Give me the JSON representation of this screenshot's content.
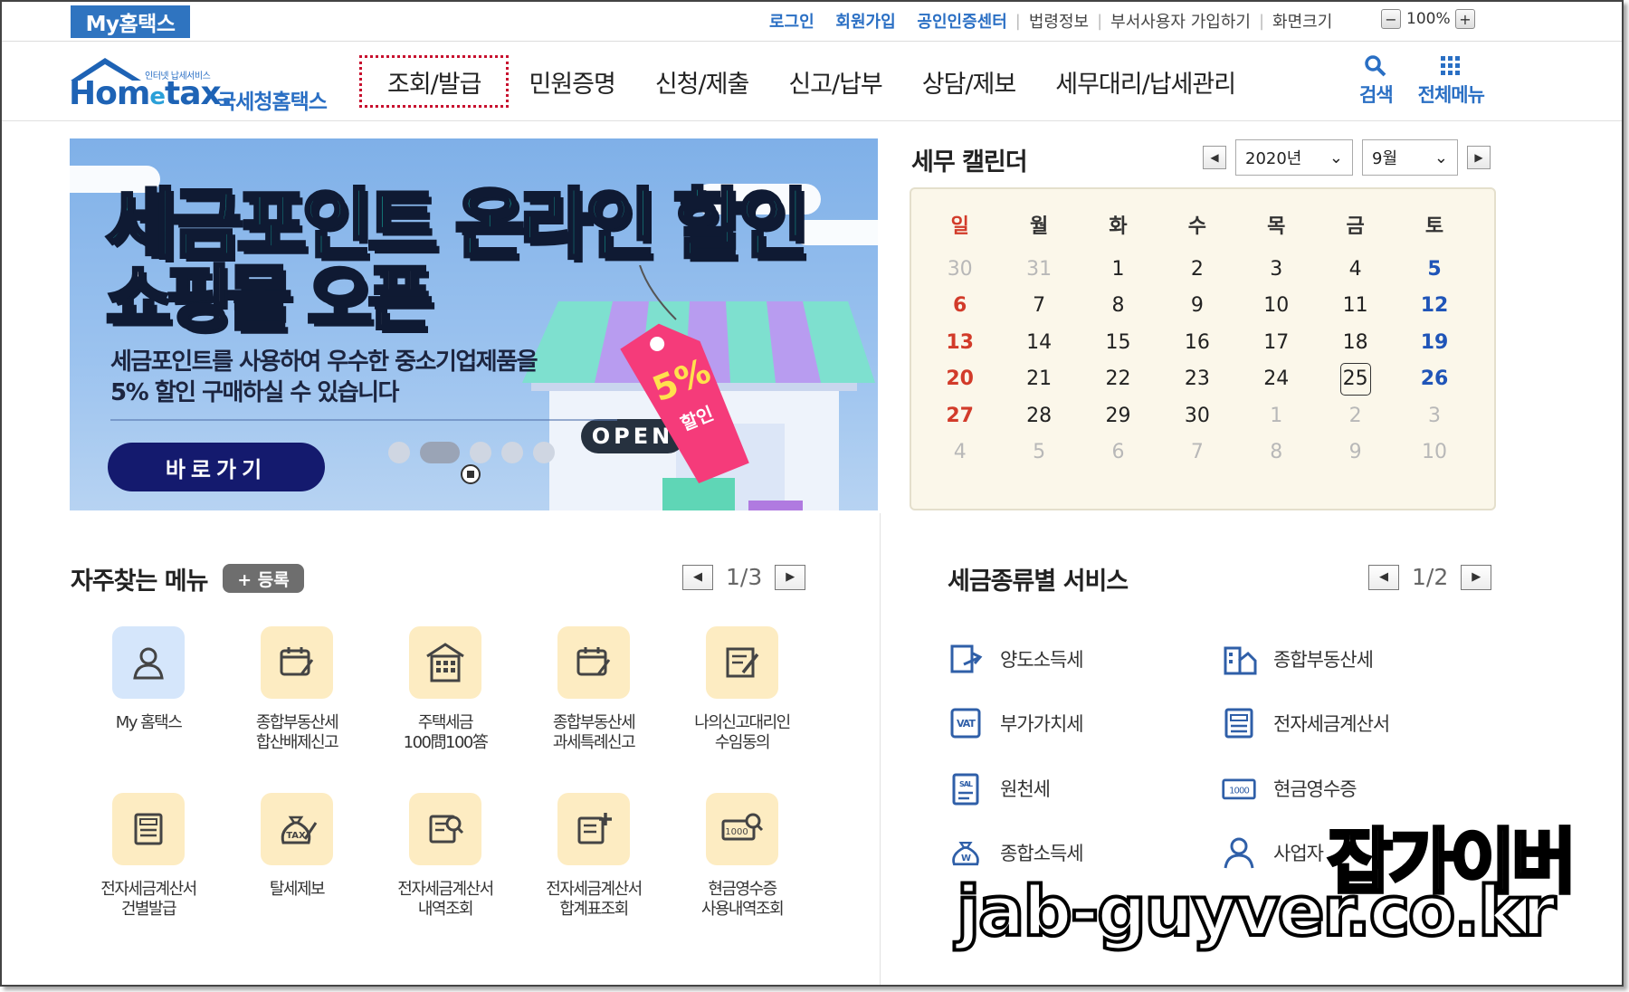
{
  "top": {
    "my_hometax": "My홈택스",
    "links": [
      "로그인",
      "회원가입",
      "공인인증센터",
      "법령정보",
      "부서사용자 가입하기",
      "화면크기"
    ],
    "zoom": "100%"
  },
  "logo": {
    "subtitle": "인터넷 납세서비스",
    "word": "Hom",
    "word_e": "e",
    "word_tail": "tax.",
    "korean": "국세청홈택스"
  },
  "nav": {
    "items": [
      "조회/발급",
      "민원증명",
      "신청/제출",
      "신고/납부",
      "상담/제보",
      "세무대리/납세관리"
    ],
    "active_index": 0,
    "search": "검색",
    "all_menu": "전체메뉴"
  },
  "banner": {
    "title1": "세금포인트 온라인 할인",
    "title2": "쇼핑몰 오픈",
    "desc1": "세금포인트를 사용하여 우수한 중소기업제품을",
    "desc2": "5% 할인 구매하실 수 있습니다",
    "button": "바로가기",
    "tag": "5%",
    "tag_sub": "할인",
    "open_sign": "OPEN"
  },
  "calendar": {
    "title": "세무 캘린더",
    "year": "2020년",
    "month": "9월",
    "weekdays": [
      "일",
      "월",
      "화",
      "수",
      "목",
      "금",
      "토"
    ],
    "weeks": [
      [
        "30",
        "31",
        "1",
        "2",
        "3",
        "4",
        "5"
      ],
      [
        "6",
        "7",
        "8",
        "9",
        "10",
        "11",
        "12"
      ],
      [
        "13",
        "14",
        "15",
        "16",
        "17",
        "18",
        "19"
      ],
      [
        "20",
        "21",
        "22",
        "23",
        "24",
        "25",
        "26"
      ],
      [
        "27",
        "28",
        "29",
        "30",
        "1",
        "2",
        "3"
      ],
      [
        "4",
        "5",
        "6",
        "7",
        "8",
        "9",
        "10"
      ]
    ],
    "today": "25"
  },
  "frequent": {
    "title": "자주찾는 메뉴",
    "register": "+ 등록",
    "page": "1/3",
    "items": [
      {
        "label": "My 홈택스",
        "icon": "user-icon"
      },
      {
        "label": "종합부동산세\n합산배제신고",
        "icon": "calendar-pen-icon"
      },
      {
        "label": "주택세금\n100問100答",
        "icon": "building-icon"
      },
      {
        "label": "종합부동산세\n과세특례신고",
        "icon": "calendar-pen-icon"
      },
      {
        "label": "나의신고대리인\n수임동의",
        "icon": "document-pen-icon"
      },
      {
        "label": "전자세금계산서\n건별발급",
        "icon": "invoice-icon"
      },
      {
        "label": "탈세제보",
        "icon": "tax-bag-icon"
      },
      {
        "label": "전자세금계산서\n내역조회",
        "icon": "invoice-search-icon"
      },
      {
        "label": "전자세금계산서\n합계표조회",
        "icon": "invoice-plus-icon"
      },
      {
        "label": "현금영수증\n사용내역조회",
        "icon": "receipt-search-icon"
      }
    ]
  },
  "tax_services": {
    "title": "세금종류별 서비스",
    "page": "1/2",
    "items": [
      {
        "label": "양도소득세",
        "icon": "transfer-doc-icon"
      },
      {
        "label": "종합부동산세",
        "icon": "real-estate-icon"
      },
      {
        "label": "부가가치세",
        "icon": "vat-icon"
      },
      {
        "label": "전자세금계산서",
        "icon": "invoice-icon"
      },
      {
        "label": "원천세",
        "icon": "salary-icon"
      },
      {
        "label": "현금영수증",
        "icon": "cash-receipt-icon"
      },
      {
        "label": "종합소득세",
        "icon": "money-bag-icon"
      },
      {
        "label": "사업자",
        "icon": "person-icon"
      }
    ]
  },
  "watermark": {
    "line1": "잡가이버",
    "line2": "jab-guyver.co.kr"
  },
  "colors": {
    "brand_blue": "#2f74c0",
    "active_border": "#c8102e",
    "sunday": "#d23b2a",
    "saturday": "#2055b8",
    "banner_button": "#141a6e"
  }
}
